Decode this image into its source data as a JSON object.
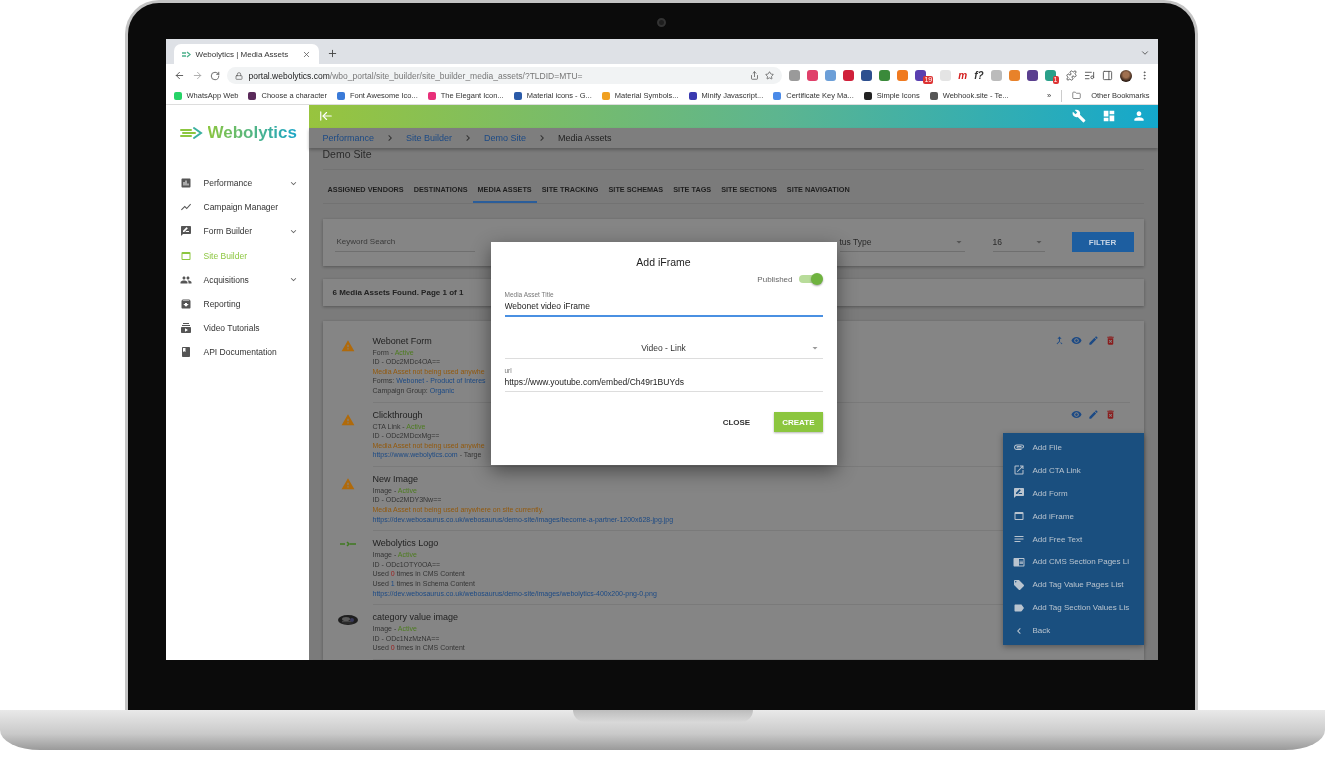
{
  "browser": {
    "tab": {
      "title": "Webolytics | Media Assets",
      "selected": true
    },
    "address": {
      "host": "portal.webolytics.com",
      "path": "/wbo_portal/site_builder/site_builder_media_assets/?TLDID=MTU="
    },
    "extensions": [
      {
        "kind": "dot",
        "color": "#9a9a9a"
      },
      {
        "kind": "dot",
        "color": "#e0406a"
      },
      {
        "kind": "dot",
        "color": "#6c9fd8"
      },
      {
        "kind": "dot",
        "color": "#d0203a"
      },
      {
        "kind": "dot",
        "color": "#2d4f8f"
      },
      {
        "kind": "dot",
        "color": "#3a8a3a"
      },
      {
        "kind": "dot",
        "color": "#f07a20"
      },
      {
        "kind": "dot",
        "color": "#5a3fb0",
        "badge": "19"
      },
      {
        "kind": "dot",
        "color": "#e4e4e4"
      },
      {
        "kind": "glyph",
        "text": "m",
        "color": "#d42020"
      },
      {
        "kind": "glyph",
        "text": "f?",
        "color": "#333333"
      },
      {
        "kind": "dot",
        "color": "#bbbbbb"
      },
      {
        "kind": "dot",
        "color": "#e8822a"
      },
      {
        "kind": "dot",
        "color": "#5a3f8f"
      },
      {
        "kind": "dot",
        "color": "#2aa08a",
        "badge": "1"
      }
    ],
    "bookmarks": [
      {
        "label": "WhatsApp Web",
        "color": "#25d366"
      },
      {
        "label": "Choose a character",
        "color": "#5a2a5a"
      },
      {
        "label": "Font Awesome Ico...",
        "color": "#3a7ad8"
      },
      {
        "label": "The Elegant Icon...",
        "color": "#e8307a"
      },
      {
        "label": "Material icons - G...",
        "color": "#2a5aa8"
      },
      {
        "label": "Material Symbols...",
        "color": "#f0a020"
      },
      {
        "label": "Minify Javascript...",
        "color": "#3a3ab0"
      },
      {
        "label": "Certificate Key Ma...",
        "color": "#4a8ae8"
      },
      {
        "label": "Simple Icons",
        "color": "#222222"
      },
      {
        "label": "Webhook.site - Te...",
        "color": "#555555"
      }
    ],
    "overflow": "»",
    "other_bookmarks": "Other Bookmarks"
  },
  "sidebar": {
    "logo": "Webolytics",
    "items": [
      {
        "label": "Performance",
        "kind": "group",
        "selected": false
      },
      {
        "label": "Campaign Manager",
        "kind": "link",
        "selected": false
      },
      {
        "label": "Form Builder",
        "kind": "group",
        "selected": false
      },
      {
        "label": "Site Builder",
        "kind": "link",
        "selected": true
      },
      {
        "label": "Acquisitions",
        "kind": "group",
        "selected": false
      },
      {
        "label": "Reporting",
        "kind": "link",
        "selected": false
      },
      {
        "label": "Video Tutorials",
        "kind": "link",
        "selected": false
      },
      {
        "label": "API Documentation",
        "kind": "link",
        "selected": false
      }
    ]
  },
  "breadcrumb": [
    {
      "label": "Performance",
      "selected": false
    },
    {
      "label": "Site Builder",
      "selected": false
    },
    {
      "label": "Demo Site",
      "selected": false
    },
    {
      "label": "Media Assets",
      "selected": true
    }
  ],
  "page_title": "Demo Site",
  "tabs": [
    {
      "label": "ASSIGNED VENDORS",
      "selected": false
    },
    {
      "label": "DESTINATIONS",
      "selected": false
    },
    {
      "label": "MEDIA ASSETS",
      "selected": true
    },
    {
      "label": "SITE TRACKING",
      "selected": false
    },
    {
      "label": "SITE SCHEMAS",
      "selected": false
    },
    {
      "label": "SITE TAGS",
      "selected": false
    },
    {
      "label": "SITE SECTIONS",
      "selected": false
    },
    {
      "label": "SITE NAVIGATION",
      "selected": false
    }
  ],
  "filters": {
    "keyword": {
      "placeholder": "Keyword Search"
    },
    "status": "tus Type",
    "per_page": "16",
    "button": "FILTER"
  },
  "results": "6 Media Assets Found. Page 1 of 1",
  "assets": [
    {
      "kind": "warning",
      "title": "Webonet Form",
      "actions": [
        {
          "kind": "fork"
        },
        {
          "kind": "view"
        },
        {
          "kind": "edit"
        },
        {
          "kind": "delete"
        }
      ],
      "lines": [
        [
          {
            "text": "Form - ",
            "kind": "plain"
          },
          {
            "text": "Active",
            "kind": "status"
          }
        ],
        [
          {
            "text": "ID - ODc2MDc4OA==",
            "kind": "plain"
          }
        ],
        [
          {
            "text": "Media Asset not being used anywhe",
            "kind": "warning"
          }
        ],
        [
          {
            "text": "Forms: ",
            "kind": "plain"
          },
          {
            "text": "Webonet - Product of Interes",
            "kind": "link"
          }
        ],
        [
          {
            "text": "Campaign Group: ",
            "kind": "plain"
          },
          {
            "text": "Organic",
            "kind": "link"
          }
        ]
      ]
    },
    {
      "kind": "warning",
      "title": "Clickthrough",
      "actions": [
        {
          "kind": "view"
        },
        {
          "kind": "edit"
        },
        {
          "kind": "delete"
        }
      ],
      "lines": [
        [
          {
            "text": "CTA Link - ",
            "kind": "plain"
          },
          {
            "text": "Active",
            "kind": "status"
          }
        ],
        [
          {
            "text": "ID - ODc2MDcxMg==",
            "kind": "plain"
          }
        ],
        [
          {
            "text": "Media Asset not being used anywhe",
            "kind": "warning"
          }
        ],
        [
          {
            "text": "https://www.webolytics.com",
            "kind": "link"
          },
          {
            "text": " - Targe",
            "kind": "plain"
          }
        ]
      ]
    },
    {
      "kind": "warning",
      "title": "New Image",
      "lines": [
        [
          {
            "text": "Image - ",
            "kind": "plain"
          },
          {
            "text": "Active",
            "kind": "status"
          }
        ],
        [
          {
            "text": "ID - ODc2MDY3Nw==",
            "kind": "plain"
          }
        ],
        [
          {
            "text": "Media Asset not being used anywhere on site currently.",
            "kind": "warning"
          }
        ],
        [
          {
            "text": "https://dev.webosaurus.co.uk/webosaurus/demo-site/images/become-a-partner-1200x628-jpg.jpg",
            "kind": "link"
          }
        ]
      ]
    },
    {
      "kind": "logo",
      "title": "Webolytics Logo",
      "lines": [
        [
          {
            "text": "Image - ",
            "kind": "plain"
          },
          {
            "text": "Active",
            "kind": "status"
          }
        ],
        [
          {
            "text": "ID - ODc1OTY0OA==",
            "kind": "plain"
          }
        ],
        [
          {
            "text": "Used ",
            "kind": "plain"
          },
          {
            "text": "0",
            "kind": "zero"
          },
          {
            "text": " times in CMS Content",
            "kind": "plain"
          }
        ],
        [
          {
            "text": "Used ",
            "kind": "plain"
          },
          {
            "text": "1",
            "kind": "count"
          },
          {
            "text": " times in Schema Content",
            "kind": "plain"
          }
        ],
        [
          {
            "text": "https://dev.webosaurus.co.uk/webosaurus/demo-site/images/webolytics-400x200-png-0.png",
            "kind": "link"
          }
        ]
      ]
    },
    {
      "kind": "picture",
      "title": "category value image",
      "lines": [
        [
          {
            "text": "Image - ",
            "kind": "plain"
          },
          {
            "text": "Active",
            "kind": "status"
          }
        ],
        [
          {
            "text": "ID - ODc1NzMzNA==",
            "kind": "plain"
          }
        ],
        [
          {
            "text": "Used ",
            "kind": "plain"
          },
          {
            "text": "0",
            "kind": "zero"
          },
          {
            "text": " times in CMS Content",
            "kind": "plain"
          }
        ]
      ]
    }
  ],
  "dialog": {
    "title": "Add iFrame",
    "published": {
      "label": "Published",
      "on": true
    },
    "title_field": {
      "label": "Media Asset Title",
      "value": "Webonet video iFrame"
    },
    "type_select": "Video - Link",
    "url_field": {
      "label": "url",
      "value": "https://www.youtube.com/embed/Ch49r1BUYds"
    },
    "buttons": [
      {
        "label": "CLOSE",
        "kind": "text"
      },
      {
        "label": "CREATE",
        "kind": "primary"
      }
    ]
  },
  "add_menu": [
    {
      "label": "Add File"
    },
    {
      "label": "Add CTA Link"
    },
    {
      "label": "Add Form"
    },
    {
      "label": "Add iFrame"
    },
    {
      "label": "Add Free Text"
    },
    {
      "label": "Add CMS Section Pages Li"
    },
    {
      "label": "Add Tag Value Pages List"
    },
    {
      "label": "Add Tag Section Values Lis"
    },
    {
      "label": "Back"
    }
  ]
}
